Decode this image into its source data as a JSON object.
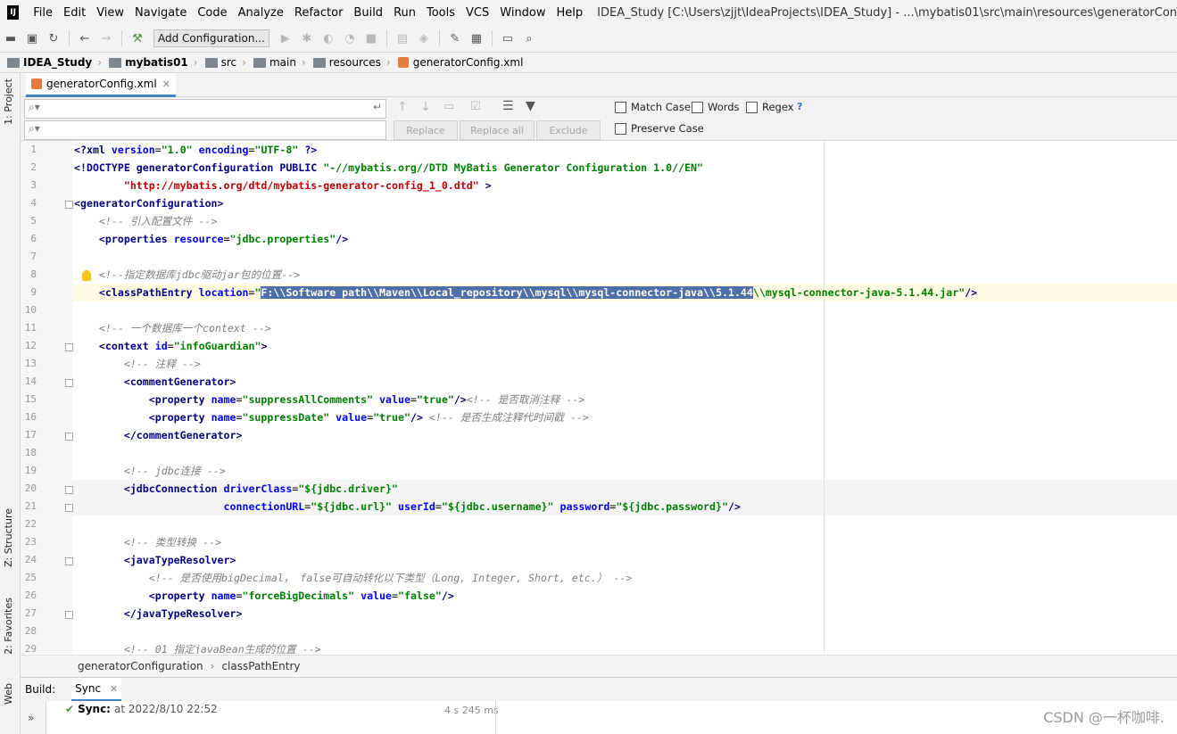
{
  "menubar": {
    "items": [
      "File",
      "Edit",
      "View",
      "Navigate",
      "Code",
      "Analyze",
      "Refactor",
      "Build",
      "Run",
      "Tools",
      "VCS",
      "Window",
      "Help"
    ],
    "window_title": "IDEA_Study [C:\\Users\\zjjt\\IdeaProjects\\IDEA_Study] - ...\\mybatis01\\src\\main\\resources\\generatorConfig.xml [mybatis01] -"
  },
  "toolbar": {
    "run_config_label": "Add Configuration..."
  },
  "breadcrumb": {
    "items": [
      "IDEA_Study",
      "mybatis01",
      "src",
      "main",
      "resources",
      "generatorConfig.xml"
    ]
  },
  "left_strip": {
    "project": "1: Project",
    "structure": "Z: Structure",
    "favorites": "2: Favorites",
    "web": "Web"
  },
  "editor_tab": {
    "label": "generatorConfig.xml"
  },
  "find": {
    "search_value": "",
    "replace_value": "",
    "replace_label": "Replace",
    "replace_all_label": "Replace all",
    "exclude_label": "Exclude",
    "match_case": "Match Case",
    "words": "Words",
    "regex": "Regex",
    "help": "?",
    "preserve_case": "Preserve Case"
  },
  "code": {
    "line_numbers": [
      "1",
      "2",
      "3",
      "4",
      "5",
      "6",
      "7",
      "8",
      "9",
      "10",
      "11",
      "12",
      "13",
      "14",
      "15",
      "16",
      "17",
      "18",
      "19",
      "20",
      "21",
      "22",
      "23",
      "24",
      "25",
      "26",
      "27",
      "28",
      "29"
    ],
    "l1a": "<?xml ",
    "l1b": "version",
    "l1c": "=",
    "l1d": "\"1.0\"",
    "l1e": " encoding",
    "l1f": "=",
    "l1g": "\"UTF-8\"",
    "l1h": " ?>",
    "l2a": "<!DOCTYPE generatorConfiguration PUBLIC ",
    "l2b": "\"-//mybatis.org//DTD MyBatis Generator Configuration 1.0//EN\"",
    "l3a": "        ",
    "l3b": "\"http://mybatis.org/dtd/mybatis-generator-config_1_0.dtd\"",
    "l3c": " >",
    "l4a": "<generatorConfiguration>",
    "l5a": "    <!-- 引入配置文件 -->",
    "l6a": "    <properties ",
    "l6b": "resource",
    "l6c": "=",
    "l6d": "\"jdbc.properties\"",
    "l6e": "/>",
    "l8a": "    <!--指定数据库jdbc驱动jar包的位置-->",
    "l9a": "    <classPathEntry ",
    "l9b": "location",
    "l9c": "=",
    "l9d": "\"",
    "l9sel": "F:\\\\Software path\\\\Maven\\\\Local_repository\\\\mysql\\\\mysql-connector-java\\\\5.1.44",
    "l9e": "\\\\mysql-connector-java-5.1.44.jar\"",
    "l9f": "/>",
    "l11a": "    <!-- 一个数据库一个context -->",
    "l12a": "    <context ",
    "l12b": "id",
    "l12c": "=",
    "l12d": "\"infoGuardian\"",
    "l12e": ">",
    "l13a": "        <!-- 注释 -->",
    "l14a": "        <commentGenerator>",
    "l15a": "            <property ",
    "l15b": "name",
    "l15c": "=",
    "l15d": "\"suppressAllComments\"",
    "l15e": " value",
    "l15f": "=",
    "l15g": "\"true\"",
    "l15h": "/>",
    "l15i": "<!-- 是否取消注释 -->",
    "l16a": "            <property ",
    "l16b": "name",
    "l16c": "=",
    "l16d": "\"suppressDate\"",
    "l16e": " value",
    "l16f": "=",
    "l16g": "\"true\"",
    "l16h": "/>",
    "l16i": " <!-- 是否生成注释代时间戳 -->",
    "l17a": "        </commentGenerator>",
    "l19a": "        <!-- jdbc连接 -->",
    "l20a": "        <jdbcConnection ",
    "l20b": "driverClass",
    "l20c": "=",
    "l20d": "\"${jdbc.driver}\"",
    "l21a": "                        ",
    "l21b": "connectionURL",
    "l21c": "=",
    "l21d": "\"${jdbc.url}\"",
    "l21e": " userId",
    "l21f": "=",
    "l21g": "\"${jdbc.username}\"",
    "l21h": " password",
    "l21i": "=",
    "l21j": "\"${jdbc.password}\"",
    "l21k": "/>",
    "l23a": "        <!-- 类型转换 -->",
    "l24a": "        <javaTypeResolver>",
    "l25a": "            <!-- 是否使用bigDecimal， false可自动转化以下类型（Long, Integer, Short, etc.） -->",
    "l26a": "            <property ",
    "l26b": "name",
    "l26c": "=",
    "l26d": "\"forceBigDecimals\"",
    "l26e": " value",
    "l26f": "=",
    "l26g": "\"false\"",
    "l26h": "/>",
    "l27a": "        </javaTypeResolver>",
    "l29a": "        <!-- 01 指定javaBean生成的位置 -->"
  },
  "editor_breadcrumb": {
    "first": "generatorConfiguration",
    "sep": "›",
    "second": "classPathEntry"
  },
  "build": {
    "title": "Build:",
    "tab": "Sync",
    "sync_label": "Sync:",
    "sync_time": "at 2022/8/10 22:52",
    "duration": "4 s 245 ms",
    "expand": "»"
  },
  "watermark": "CSDN @一杯咖啡."
}
